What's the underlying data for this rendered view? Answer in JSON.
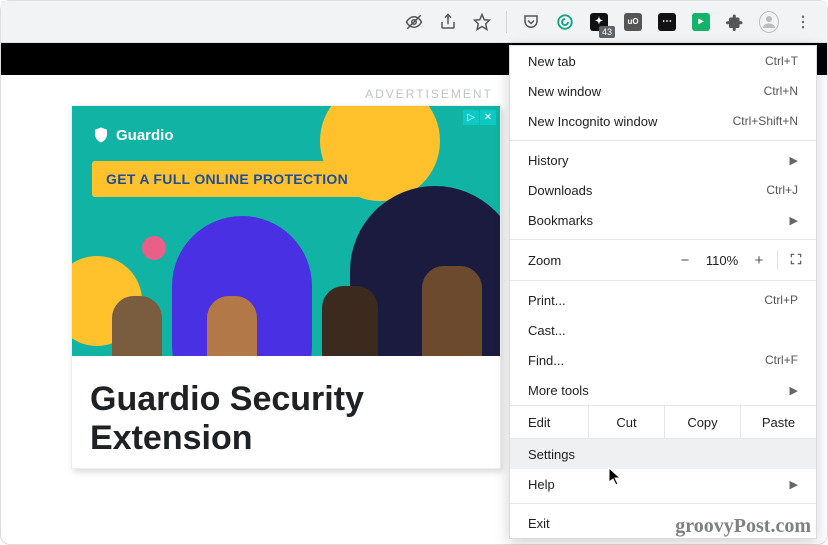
{
  "toolbar": {
    "ext_badge": "43"
  },
  "page": {
    "ad_label": "ADVERTISEMENT",
    "brand": "Guardio",
    "cta": "GET A FULL ONLINE PROTECTION",
    "headline": "Guardio Security Extension",
    "watermark": "groovyPost.com"
  },
  "menu": {
    "new_tab": {
      "label": "New tab",
      "shortcut": "Ctrl+T"
    },
    "new_window": {
      "label": "New window",
      "shortcut": "Ctrl+N"
    },
    "incognito": {
      "label": "New Incognito window",
      "shortcut": "Ctrl+Shift+N"
    },
    "history": {
      "label": "History"
    },
    "downloads": {
      "label": "Downloads",
      "shortcut": "Ctrl+J"
    },
    "bookmarks": {
      "label": "Bookmarks"
    },
    "zoom": {
      "label": "Zoom",
      "minus": "−",
      "pct": "110%",
      "plus": "+"
    },
    "print": {
      "label": "Print...",
      "shortcut": "Ctrl+P"
    },
    "cast": {
      "label": "Cast..."
    },
    "find": {
      "label": "Find...",
      "shortcut": "Ctrl+F"
    },
    "more_tools": {
      "label": "More tools"
    },
    "edit": {
      "label": "Edit",
      "cut": "Cut",
      "copy": "Copy",
      "paste": "Paste"
    },
    "settings": {
      "label": "Settings"
    },
    "help": {
      "label": "Help"
    },
    "exit": {
      "label": "Exit"
    }
  }
}
